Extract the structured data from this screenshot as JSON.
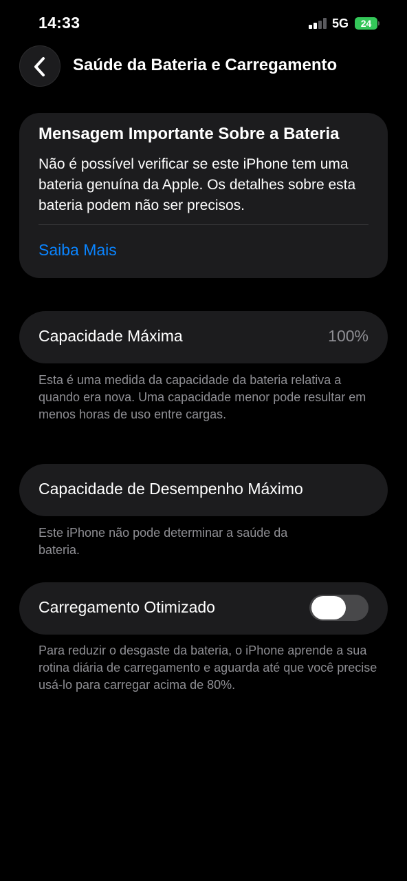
{
  "status_bar": {
    "time": "14:33",
    "network": "5G",
    "battery": "24",
    "signal_bars_active": 2,
    "signal_bars_total": 4
  },
  "nav": {
    "back_icon": "chevron-left-icon",
    "title": "Saúde da Bateria e Carregamento"
  },
  "message": {
    "title": "Mensagem Importante Sobre a Bateria",
    "body": "Não é possível verificar se este iPhone tem uma bateria genuína da Apple. Os detalhes sobre esta bateria podem não ser precisos.",
    "link": "Saiba Mais"
  },
  "max_capacity": {
    "label": "Capacidade Máxima",
    "value": "100%",
    "footnote": "Esta é uma medida da capacidade da bateria relativa a quando era nova. Uma capacidade menor pode resultar em menos horas de uso entre cargas."
  },
  "peak_performance": {
    "label": "Capacidade de Desempenho Máximo",
    "footnote": "Este iPhone não pode determinar a saúde da bateria."
  },
  "optimized_charging": {
    "label": "Carregamento Otimizado",
    "enabled": false,
    "footnote": "Para reduzir o desgaste da bateria, o iPhone aprende a sua rotina diária de carregamento e aguarda até que você precise usá-lo para carregar acima de 80%."
  },
  "colors": {
    "background": "#000000",
    "card": "#1c1c1e",
    "link": "#0a84ff",
    "secondary_text": "#8e8e93",
    "battery": "#34c759",
    "toggle_off": "#48484a"
  }
}
